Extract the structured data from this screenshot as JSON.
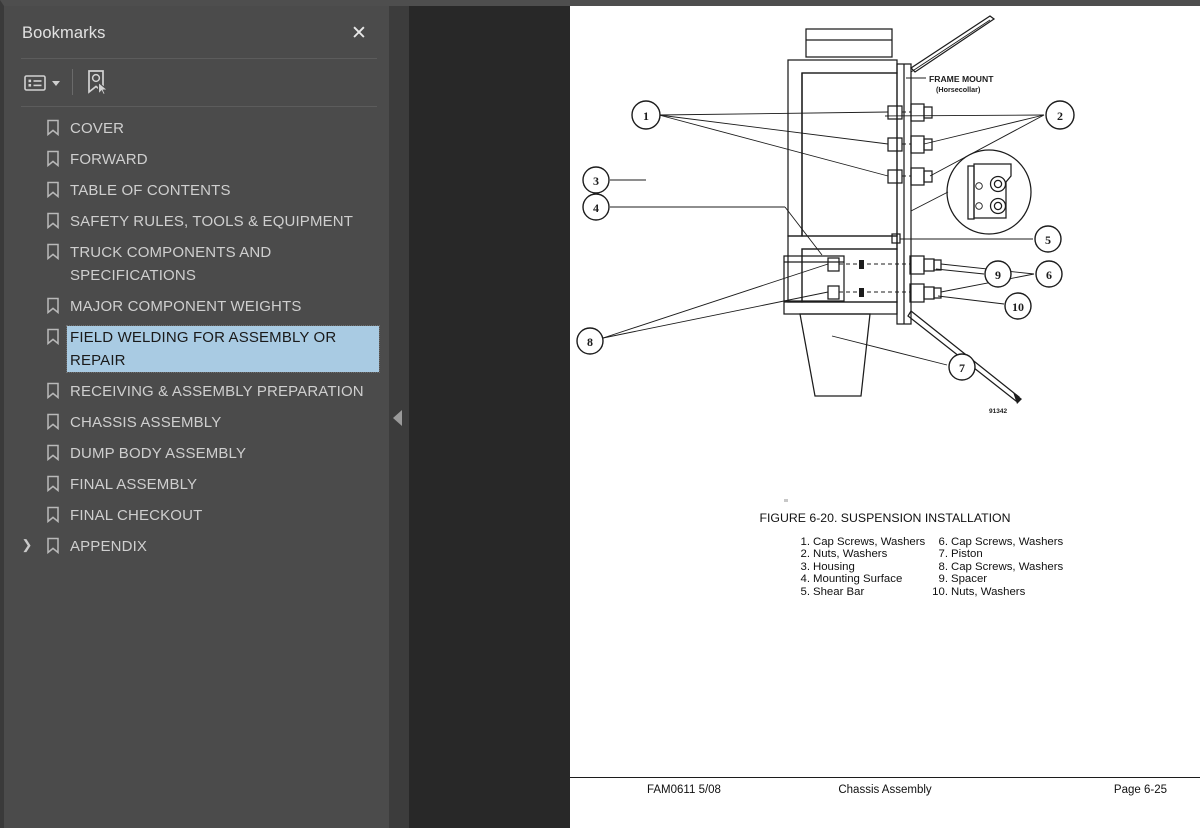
{
  "sidebar": {
    "title": "Bookmarks",
    "close_label": "✕",
    "toolbar": {
      "list_options_icon": "list-options-icon",
      "new_bookmark_icon": "new-bookmark-icon"
    },
    "items": [
      {
        "label": "COVER",
        "selected": false,
        "expandable": false
      },
      {
        "label": "FORWARD",
        "selected": false,
        "expandable": false
      },
      {
        "label": "TABLE OF CONTENTS",
        "selected": false,
        "expandable": false
      },
      {
        "label": "SAFETY RULES, TOOLS & EQUIPMENT",
        "selected": false,
        "expandable": false
      },
      {
        "label": "TRUCK COMPONENTS AND SPECIFICATIONS",
        "selected": false,
        "expandable": false
      },
      {
        "label": "MAJOR COMPONENT WEIGHTS",
        "selected": false,
        "expandable": false
      },
      {
        "label": "FIELD WELDING FOR ASSEMBLY OR REPAIR",
        "selected": true,
        "expandable": false
      },
      {
        "label": "RECEIVING & ASSEMBLY PREPARATION",
        "selected": false,
        "expandable": false
      },
      {
        "label": "CHASSIS ASSEMBLY",
        "selected": false,
        "expandable": false
      },
      {
        "label": "DUMP BODY ASSEMBLY",
        "selected": false,
        "expandable": false
      },
      {
        "label": "FINAL ASSEMBLY",
        "selected": false,
        "expandable": false
      },
      {
        "label": "FINAL CHECKOUT",
        "selected": false,
        "expandable": false
      },
      {
        "label": "APPENDIX",
        "selected": false,
        "expandable": true
      }
    ],
    "collapse_handle_icon": "collapse-panel-arrow-icon"
  },
  "document": {
    "figure": {
      "caption": "FIGURE 6-20. SUSPENSION INSTALLATION",
      "drawing_number": "91342",
      "annotations": [
        {
          "text": "FRAME MOUNT",
          "sub": "(Horsecollar)"
        }
      ],
      "callouts": [
        "1",
        "2",
        "3",
        "4",
        "5",
        "6",
        "7",
        "8",
        "9",
        "10"
      ],
      "parts_left": [
        {
          "num": "1.",
          "name": "Cap Screws, Washers"
        },
        {
          "num": "2.",
          "name": "Nuts, Washers"
        },
        {
          "num": "3.",
          "name": "Housing"
        },
        {
          "num": "4.",
          "name": "Mounting Surface"
        },
        {
          "num": "5.",
          "name": "Shear Bar"
        }
      ],
      "parts_right": [
        {
          "num": "6.",
          "name": "Cap Screws, Washers"
        },
        {
          "num": "7.",
          "name": "Piston"
        },
        {
          "num": "8.",
          "name": "Cap Screws, Washers"
        },
        {
          "num": "9.",
          "name": "Spacer"
        },
        {
          "num": "10.",
          "name": "Nuts, Washers"
        }
      ]
    },
    "footer": {
      "left": "FAM0611  5/08",
      "center": "Chassis Assembly",
      "right": "Page 6-25"
    }
  },
  "colors": {
    "sidebar_bg": "#4b4b4b",
    "viewer_bg": "#282828",
    "page_bg": "#ffffff",
    "selection_highlight": "#a9cbe3",
    "text_muted": "#cfcfcf"
  }
}
